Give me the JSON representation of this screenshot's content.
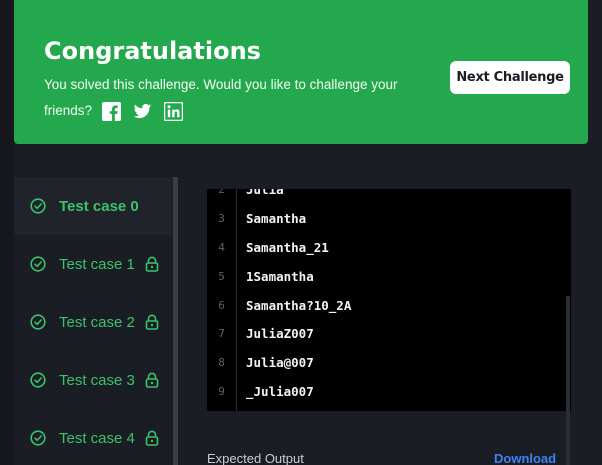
{
  "banner": {
    "title": "Congratulations",
    "message": "You solved this challenge. Would you like to challenge your friends?",
    "next_button_label": "Next Challenge",
    "color": "#24a84d"
  },
  "social_icons": [
    "facebook-icon",
    "twitter-icon",
    "linkedin-icon"
  ],
  "test_cases": [
    {
      "label": "Test case 0",
      "status": "passed",
      "locked": false,
      "active": true
    },
    {
      "label": "Test case 1",
      "status": "passed",
      "locked": true,
      "active": false
    },
    {
      "label": "Test case 2",
      "status": "passed",
      "locked": true,
      "active": false
    },
    {
      "label": "Test case 3",
      "status": "passed",
      "locked": true,
      "active": false
    },
    {
      "label": "Test case 4",
      "status": "passed",
      "locked": true,
      "active": false
    }
  ],
  "input_lines": [
    {
      "num": "2",
      "text": "Julia"
    },
    {
      "num": "3",
      "text": "Samantha"
    },
    {
      "num": "4",
      "text": "Samantha_21"
    },
    {
      "num": "5",
      "text": "1Samantha"
    },
    {
      "num": "6",
      "text": "Samantha?10_2A"
    },
    {
      "num": "7",
      "text": "JuliaZ007"
    },
    {
      "num": "8",
      "text": "Julia@007"
    },
    {
      "num": "9",
      "text": "_Julia007"
    }
  ],
  "expected_output_label": "Expected Output",
  "download_label": "Download",
  "colors": {
    "success": "#39c36a",
    "link": "#3b82f6",
    "background": "#1a1d24"
  }
}
